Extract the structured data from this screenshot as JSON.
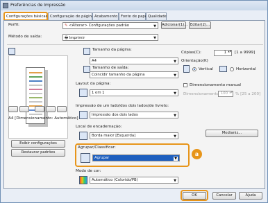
{
  "window": {
    "title": "Preferências de Impressão"
  },
  "tabs": [
    {
      "label": "Configurações básicas"
    },
    {
      "label": "Configuração de página"
    },
    {
      "label": "Acabamento"
    },
    {
      "label": "Fonte de papel"
    },
    {
      "label": "Qualidade"
    }
  ],
  "profile": {
    "label": "Perfil:",
    "value": "<Alterar> Configurações padrão",
    "add_label": "Adicionar(1)...",
    "edit_label": "Editar(2)..."
  },
  "output": {
    "label": "Método de saída:",
    "value": "Imprimir"
  },
  "preview": {
    "caption": "A4 [Dimensionamento: Automático]",
    "settings_button": "Exibir configurações",
    "restore_button": "Restaurar padrões"
  },
  "page_size": {
    "label": "Tamanho da página:",
    "value": "A4"
  },
  "output_size": {
    "label": "Tamanho de saída:",
    "value": "Coincidir tamanho da página"
  },
  "copies": {
    "label": "Cópias(C):",
    "value": "1",
    "range": "[1 a 9999]"
  },
  "orientation": {
    "label": "Orientação(K)",
    "portrait": "Vertical",
    "landscape": "Horizontal",
    "selected": "Vertical"
  },
  "layout": {
    "label": "Layout da página:",
    "value": "1 em 1"
  },
  "manual_scaling": {
    "label": "Dimensionamento manual",
    "field_label": "Dimensionamento:",
    "value": "100",
    "range": "% [25 a 200]"
  },
  "duplex": {
    "label": "Impressão de um lado/dos dois lados/de livreto:",
    "value": "Impressão dos dois lados"
  },
  "binding": {
    "label": "Local de encadernação:",
    "value": "Borda maior [Esquerda]",
    "margin_button": "Medianiz..."
  },
  "collate": {
    "label": "Agrupar/Classificar:",
    "value": "Agrupar",
    "callout": "a"
  },
  "color_mode": {
    "label": "Modo de cor:",
    "value": "Automático (Colorido/PB)"
  },
  "footer": {
    "ok": "OK",
    "cancel": "Cancelar",
    "help": "Ajuda"
  },
  "colors": {
    "highlight": "#e7951a",
    "accent": "#1e5fbf"
  }
}
